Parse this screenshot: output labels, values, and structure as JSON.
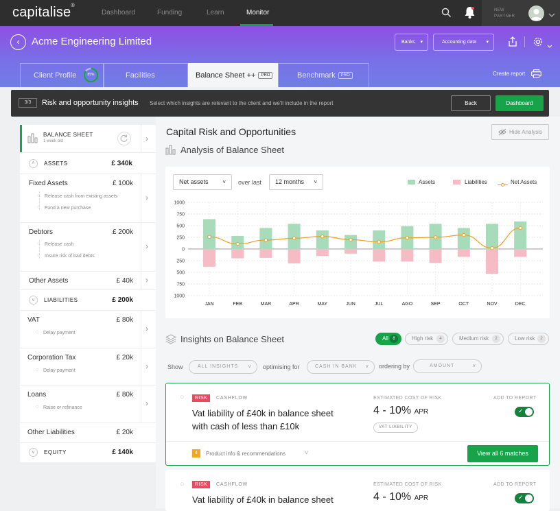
{
  "app": {
    "logo": "capitalise",
    "trademark": "®"
  },
  "nav": [
    "Dashboard",
    "Funding",
    "Learn",
    "Monitor"
  ],
  "partner_label": [
    "NEW",
    "PARTNER"
  ],
  "company": "Acme Engineering Limited",
  "header_buttons": {
    "banks": "Banks",
    "accounting": "Accounting data"
  },
  "tabs": [
    {
      "label": "Client Profile",
      "badge": "85%"
    },
    {
      "label": "Facilities"
    },
    {
      "label": "Balance Sheet ++",
      "pro": "PRO"
    },
    {
      "label": "Benchmark",
      "pro": "PRO"
    }
  ],
  "create_report": "Create report",
  "banner": {
    "step": "3/3",
    "title": "Risk and opportunity insights",
    "subtitle": "Select which insights are relevant to the client and we'll include in the report",
    "back": "Back",
    "dashboard": "Dashboard"
  },
  "sidebar": {
    "title": "BALANCE SHEET",
    "age": "1 week old",
    "assets": {
      "label": "ASSETS",
      "value": "£ 340k"
    },
    "fixed": {
      "label": "Fixed Assets",
      "value": "£ 100k",
      "subs": [
        "Release cash from existing assets",
        "Fund a new purchase"
      ]
    },
    "debtors": {
      "label": "Debtors",
      "value": "£ 200k",
      "subs": [
        "Release cash",
        "Insure risk of bad debts"
      ]
    },
    "other_assets": {
      "label": "Other Assets",
      "value": "£ 40k"
    },
    "liabilities": {
      "label": "LIABILITIES",
      "value": "£ 200k"
    },
    "vat": {
      "label": "VAT",
      "value": "£ 80k",
      "subs": [
        "Delay payment"
      ]
    },
    "corp": {
      "label": "Corporation Tax",
      "value": "£ 20k",
      "subs": [
        "Delay payment"
      ]
    },
    "loans": {
      "label": "Loans",
      "value": "£ 80k",
      "subs": [
        "Raise or refinance"
      ]
    },
    "other_liab": {
      "label": "Other Liabilities",
      "value": "£ 20k"
    },
    "equity": {
      "label": "EQUITY",
      "value": "£ 140k"
    }
  },
  "main": {
    "title": "Capital Risk and Opportunities",
    "hide": "Hide Analysis",
    "analysis_title": "Analysis of Balance Sheet",
    "metric": "Net assets",
    "over_last": "over last",
    "period": "12 months",
    "insights_title": "Insights on Balance Sheet"
  },
  "filters": {
    "all": "All",
    "all_count": "8",
    "high": "High risk",
    "high_count": "4",
    "medium": "Medium risk",
    "medium_count": "2",
    "low": "Low risk",
    "low_count": "2"
  },
  "options": {
    "show": "Show",
    "show_val": "ALL INSIGHTS",
    "optimising": "optimising for",
    "opt_val": "CASH IN BANK",
    "ordering": "ordering by",
    "order_val": "AMOUNT"
  },
  "cards": [
    {
      "tag": "RISK",
      "category": "CASHFLOW",
      "headline": [
        "Vat liability of £40k in balance sheet",
        "with cash of less than £10k"
      ],
      "cost_label": "ESTIMATED COST OF RISK",
      "cost": "4 - 10%",
      "apr": "APR",
      "chip": "VAT LIABILITY",
      "add_label": "ADD TO REPORT",
      "product_count": "4",
      "product_label": "Product info & recommendations",
      "view_all": "View all 6 matches"
    },
    {
      "tag": "RISK",
      "category": "CASHFLOW",
      "headline": [
        "Vat liability of £40k in balance sheet"
      ],
      "cost_label": "ESTIMATED COST OF RISK",
      "cost": "4 - 10%",
      "apr": "APR",
      "add_label": "ADD TO REPORT"
    }
  ],
  "colors": {
    "green": "#16a34a",
    "asset": "#a8dbb9",
    "liability": "#f6bcc6",
    "line": "#f0a020"
  },
  "chart_data": {
    "type": "bar",
    "categories": [
      "JAN",
      "FEB",
      "MAR",
      "APR",
      "MAY",
      "JUN",
      "JUL",
      "AGO",
      "SEP",
      "OCT",
      "NOV",
      "DEC"
    ],
    "series": [
      {
        "name": "Assets",
        "values": [
          640,
          280,
          450,
          540,
          400,
          300,
          400,
          490,
          540,
          450,
          540,
          590
        ]
      },
      {
        "name": "Liabilities",
        "values": [
          -380,
          -200,
          -190,
          -310,
          -150,
          -100,
          -270,
          -270,
          -300,
          -170,
          -530,
          -170
        ]
      },
      {
        "name": "Net Assets",
        "values": [
          260,
          110,
          190,
          230,
          270,
          200,
          150,
          240,
          250,
          300,
          20,
          450
        ]
      }
    ],
    "yticks": [
      "1000",
      "750",
      "500",
      "250",
      "0",
      "250",
      "500",
      "750",
      "1000"
    ],
    "ylim": [
      -1000,
      1000
    ],
    "legend_position": "top-right"
  }
}
